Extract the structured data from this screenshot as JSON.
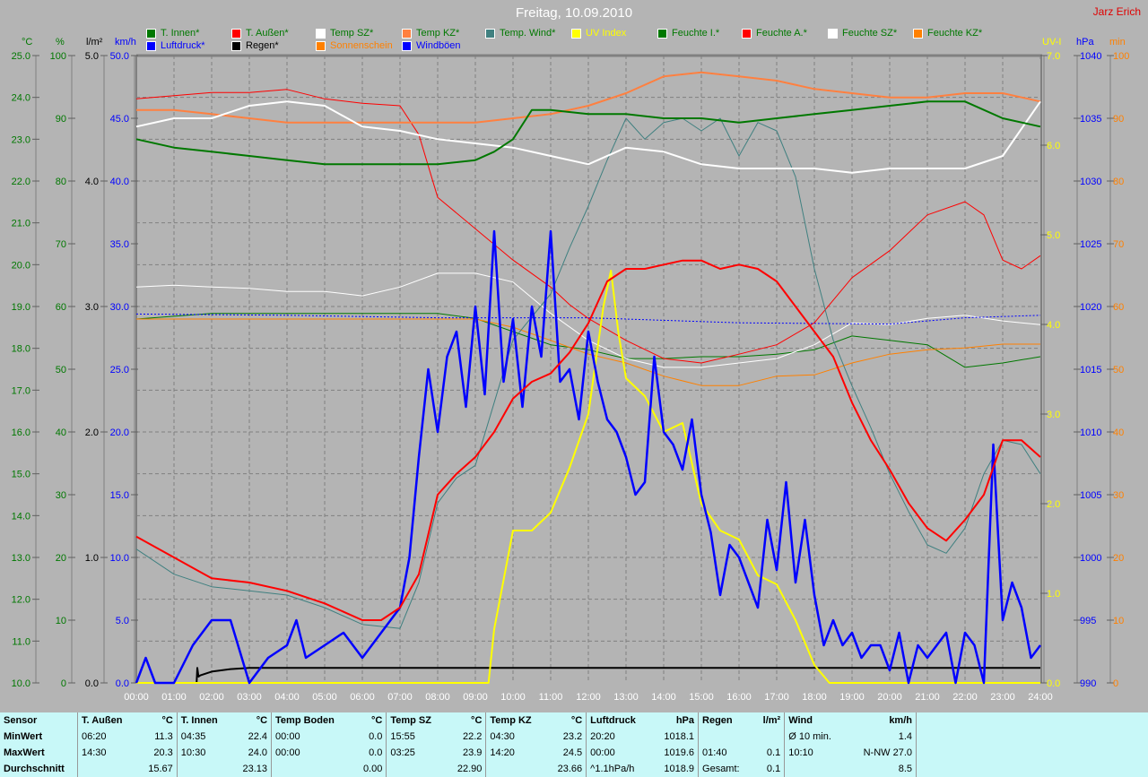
{
  "title": "Freitag, 10.09.2010",
  "author": "Jarz Erich",
  "legend": [
    {
      "label": "T. Innen*",
      "color": "#007800",
      "text": "#007800"
    },
    {
      "label": "Luftdruck*",
      "color": "#0000ff",
      "text": "#0000ff"
    },
    {
      "label": "T. Außen*",
      "color": "#ff0000",
      "text": "#007800"
    },
    {
      "label": "Regen*",
      "color": "#000000",
      "text": "#000000"
    },
    {
      "label": "Temp SZ*",
      "color": "#ffffff",
      "text": "#007800"
    },
    {
      "label": "Sonnenschein",
      "color": "#ff8000",
      "text": "#ff8000"
    },
    {
      "label": "Temp KZ*",
      "color": "#ff8040",
      "text": "#007800"
    },
    {
      "label": "Windböen",
      "color": "#0000ff",
      "text": "#0000ff"
    },
    {
      "label": "Temp. Wind*",
      "color": "#408080",
      "text": "#007800"
    },
    {
      "label": "UV Index",
      "color": "#ffff00",
      "text": "#ffff00"
    },
    {
      "label": "Feuchte I.*",
      "color": "#007800",
      "text": "#007800"
    },
    {
      "label": "Feuchte A.*",
      "color": "#ff0000",
      "text": "#007800"
    },
    {
      "label": "Feuchte SZ*",
      "color": "#ffffff",
      "text": "#007800"
    },
    {
      "label": "Feuchte KZ*",
      "color": "#ff8000",
      "text": "#007800"
    }
  ],
  "chart_data": {
    "type": "line",
    "title": "Freitag, 10.09.2010",
    "x_ticks": [
      "00:00",
      "01:00",
      "02:00",
      "03:00",
      "04:00",
      "05:00",
      "06:00",
      "07:00",
      "08:00",
      "09:00",
      "10:00",
      "11:00",
      "12:00",
      "13:00",
      "14:00",
      "15:00",
      "16:00",
      "17:00",
      "18:00",
      "19:00",
      "20:00",
      "21:00",
      "22:00",
      "23:00",
      "24:00"
    ],
    "xlim": [
      0,
      24
    ],
    "grid": true,
    "axes": [
      {
        "id": "c",
        "unit": "°C",
        "min": 10,
        "max": 25,
        "step": 1,
        "decimals": 1,
        "color": "#007800",
        "side": "left"
      },
      {
        "id": "pct",
        "unit": "%",
        "min": 0,
        "max": 100,
        "step": 10,
        "decimals": 0,
        "color": "#007800",
        "side": "left"
      },
      {
        "id": "rain",
        "unit": "l/m²",
        "min": 0,
        "max": 5,
        "step": 1,
        "decimals": 1,
        "color": "#000000",
        "side": "left"
      },
      {
        "id": "kmh",
        "unit": "km/h",
        "min": 0,
        "max": 50,
        "step": 5,
        "decimals": 1,
        "color": "#0000ff",
        "side": "left"
      },
      {
        "id": "uv",
        "unit": "UV-I",
        "min": 0,
        "max": 7,
        "step": 1,
        "decimals": 1,
        "color": "#ffff00",
        "side": "right"
      },
      {
        "id": "hpa",
        "unit": "hPa",
        "min": 990,
        "max": 1040,
        "step": 5,
        "decimals": 0,
        "color": "#0000ff",
        "side": "right"
      },
      {
        "id": "min",
        "unit": "min",
        "min": 0,
        "max": 100,
        "step": 10,
        "decimals": 0,
        "color": "#ff8000",
        "side": "right"
      }
    ],
    "series": [
      {
        "name": "Feuchte I.*",
        "axis": "pct",
        "color": "#007800",
        "width": 1,
        "x": [
          0,
          2,
          8,
          9,
          10,
          11,
          12,
          13,
          14,
          15,
          16,
          17,
          18,
          19,
          20,
          21,
          22,
          23,
          24
        ],
        "y": [
          58,
          58.9,
          58.9,
          58.1,
          56,
          53.9,
          53.1,
          51.7,
          51.7,
          52,
          52,
          52.4,
          53.1,
          55.3,
          54.6,
          53.9,
          50.3,
          51,
          52
        ]
      },
      {
        "name": "Feuchte A.*",
        "axis": "pct",
        "color": "#ff0000",
        "width": 1,
        "x": [
          0,
          2,
          3,
          4,
          5,
          6,
          7,
          7.5,
          8,
          9,
          10,
          11,
          11.5,
          12,
          13,
          14,
          15,
          16,
          17,
          18,
          19,
          20,
          21,
          22,
          22.5,
          23,
          23.5,
          24
        ],
        "y": [
          93.1,
          94.1,
          94.1,
          94.6,
          93.1,
          92.4,
          92,
          87.4,
          77.4,
          72.4,
          67.4,
          63.1,
          60.3,
          58.1,
          54.6,
          51.7,
          51,
          52.4,
          53.9,
          57.4,
          64.6,
          68.9,
          74.6,
          76.7,
          74.6,
          67.4,
          66,
          68.1
        ]
      },
      {
        "name": "Feuchte SZ*",
        "axis": "pct",
        "color": "#ffffff",
        "width": 1,
        "x": [
          0,
          1,
          2,
          3,
          4,
          5,
          6,
          7,
          8,
          9,
          10,
          11,
          12,
          13,
          14,
          15,
          16,
          17,
          18,
          19,
          20,
          21,
          22,
          23,
          24
        ],
        "y": [
          63.1,
          63.4,
          63.1,
          62.9,
          62.4,
          62.4,
          61.7,
          63.1,
          65.3,
          65.3,
          63.9,
          58.9,
          54.6,
          51.7,
          50.3,
          50.3,
          51,
          51.7,
          53.9,
          57.4,
          57.1,
          58.1,
          58.6,
          57.7,
          57.1
        ]
      },
      {
        "name": "Feuchte KZ*",
        "axis": "pct",
        "color": "#ff8000",
        "width": 1,
        "x": [
          0,
          6,
          8,
          9,
          10,
          11,
          12,
          13,
          14,
          15,
          16,
          17,
          18,
          19,
          20,
          21,
          22,
          23,
          24
        ],
        "y": [
          58,
          58,
          58,
          58,
          56.7,
          54.6,
          52.4,
          51,
          48.9,
          47.4,
          47.4,
          48.9,
          49.1,
          51,
          52.4,
          53.1,
          53.4,
          54,
          54
        ]
      },
      {
        "name": "Temp. Wind*",
        "axis": "c",
        "color": "#408080",
        "width": 1,
        "x": [
          0,
          1,
          2,
          3,
          4,
          5,
          6,
          7,
          7.5,
          8,
          8.5,
          9,
          9.5,
          10,
          11,
          11.5,
          12,
          12.5,
          13,
          13.5,
          14,
          14.5,
          15,
          15.5,
          16,
          16.5,
          17,
          17.5,
          18,
          18.5,
          19,
          19.5,
          20,
          20.5,
          21,
          21.5,
          22,
          22.5,
          23,
          23.5,
          24
        ],
        "y": [
          13.2,
          12.6,
          12.3,
          12.2,
          12.1,
          11.8,
          11.4,
          11.3,
          12.4,
          14.3,
          14.9,
          15.2,
          16.7,
          18.2,
          19.3,
          20.4,
          21.4,
          22.5,
          23.5,
          23.0,
          23.4,
          23.5,
          23.2,
          23.5,
          22.6,
          23.4,
          23.2,
          22.1,
          19.9,
          18.2,
          17.1,
          16.1,
          15.0,
          14.1,
          13.3,
          13.1,
          13.7,
          15.0,
          15.8,
          15.7,
          15.0
        ]
      },
      {
        "name": "Regen*",
        "axis": "rain",
        "color": "#000000",
        "width": 2,
        "x": [
          0,
          1.6,
          1.62,
          1.65,
          1.7,
          2,
          2.5,
          3,
          24
        ],
        "y": [
          0,
          0,
          0.12,
          0.05,
          0.06,
          0.09,
          0.11,
          0.12,
          0.12
        ]
      },
      {
        "name": "UV Index",
        "axis": "uv",
        "color": "#ffff00",
        "width": 2,
        "x": [
          0,
          9.35,
          9.5,
          10,
          10.5,
          11,
          11.5,
          12,
          12.4,
          12.6,
          12.8,
          13,
          13.5,
          14,
          14.5,
          15,
          15.5,
          16,
          16.5,
          17,
          17.5,
          18,
          18.4,
          24
        ],
        "y": [
          0,
          0,
          0.6,
          1.7,
          1.7,
          1.9,
          2.4,
          3.0,
          4.2,
          4.6,
          3.9,
          3.4,
          3.2,
          2.8,
          2.9,
          2.0,
          1.7,
          1.6,
          1.2,
          1.1,
          0.7,
          0.2,
          0,
          0
        ]
      },
      {
        "name": "Luftdruck*",
        "axis": "hpa",
        "color": "#0000ff",
        "width": 1,
        "dash": "2,2",
        "x": [
          0,
          4,
          8,
          12,
          16,
          20,
          22,
          24
        ],
        "y": [
          1019.4,
          1019.3,
          1019.1,
          1019.1,
          1018.7,
          1018.6,
          1019.1,
          1019.3
        ]
      },
      {
        "name": "Windböen",
        "axis": "kmh",
        "color": "#0000ff",
        "width": 2.5,
        "x": [
          0,
          0.25,
          0.5,
          1,
          1.5,
          2,
          2.5,
          3,
          3.5,
          4,
          4.25,
          4.5,
          5,
          5.5,
          6,
          6.5,
          7,
          7.25,
          7.5,
          7.75,
          8,
          8.25,
          8.5,
          8.75,
          9,
          9.25,
          9.5,
          9.75,
          10,
          10.25,
          10.5,
          10.75,
          11,
          11.25,
          11.5,
          11.75,
          12,
          12.25,
          12.5,
          12.75,
          13,
          13.25,
          13.5,
          13.75,
          14,
          14.25,
          14.5,
          14.75,
          15,
          15.25,
          15.5,
          15.75,
          16,
          16.25,
          16.5,
          16.75,
          17,
          17.25,
          17.5,
          17.75,
          18,
          18.25,
          18.5,
          18.75,
          19,
          19.25,
          19.5,
          19.75,
          20,
          20.25,
          20.5,
          20.75,
          21,
          21.25,
          21.5,
          21.75,
          22,
          22.25,
          22.5,
          22.75,
          23,
          23.25,
          23.5,
          23.75,
          24
        ],
        "y": [
          0,
          2,
          0,
          0,
          3,
          5,
          5,
          0,
          2,
          3,
          5,
          2,
          3,
          4,
          2,
          4,
          6,
          10,
          18,
          25,
          20,
          26,
          28,
          22,
          30,
          23,
          36,
          24,
          29,
          22,
          30,
          26,
          36,
          24,
          25,
          21,
          28,
          24,
          21,
          20,
          18,
          15,
          16,
          26,
          20,
          19,
          17,
          21,
          15,
          12,
          7,
          11,
          10,
          8,
          6,
          13,
          9,
          16,
          8,
          13,
          7,
          3,
          5,
          3,
          4,
          2,
          3,
          3,
          1,
          4,
          0,
          3,
          2,
          3,
          4,
          0,
          4,
          3,
          0,
          19,
          5,
          8,
          6,
          2,
          3
        ]
      },
      {
        "name": "Temp KZ*",
        "axis": "c",
        "color": "#ff8040",
        "width": 2,
        "x": [
          0,
          1,
          2,
          3,
          4,
          5,
          6,
          7,
          8,
          9,
          10,
          11,
          12,
          13,
          14,
          15,
          16,
          17,
          18,
          19,
          20,
          21,
          22,
          23,
          24
        ],
        "y": [
          23.7,
          23.7,
          23.6,
          23.5,
          23.4,
          23.4,
          23.4,
          23.4,
          23.4,
          23.4,
          23.5,
          23.6,
          23.8,
          24.1,
          24.5,
          24.6,
          24.5,
          24.4,
          24.2,
          24.1,
          24.0,
          24.0,
          24.1,
          24.1,
          23.9
        ]
      },
      {
        "name": "Temp SZ*",
        "axis": "c",
        "color": "#ffffff",
        "width": 2,
        "x": [
          0,
          1,
          2,
          3,
          4,
          5,
          6,
          7,
          8,
          9,
          10,
          11,
          12,
          13,
          14,
          15,
          16,
          17,
          18,
          19,
          20,
          21,
          22,
          23,
          24
        ],
        "y": [
          23.3,
          23.5,
          23.5,
          23.8,
          23.9,
          23.8,
          23.3,
          23.2,
          23.0,
          22.9,
          22.8,
          22.6,
          22.4,
          22.8,
          22.7,
          22.4,
          22.3,
          22.3,
          22.3,
          22.2,
          22.3,
          22.3,
          22.3,
          22.6,
          23.9
        ]
      },
      {
        "name": "T. Innen*",
        "axis": "c",
        "color": "#007800",
        "width": 2,
        "x": [
          0,
          1,
          2,
          3,
          4,
          5,
          6,
          7,
          8,
          9,
          9.5,
          10,
          10.5,
          11,
          12,
          13,
          14,
          15,
          16,
          17,
          18,
          19,
          20,
          21,
          22,
          23,
          24
        ],
        "y": [
          23.0,
          22.8,
          22.7,
          22.6,
          22.5,
          22.4,
          22.4,
          22.4,
          22.4,
          22.5,
          22.7,
          23.0,
          23.7,
          23.7,
          23.6,
          23.6,
          23.5,
          23.5,
          23.4,
          23.5,
          23.6,
          23.7,
          23.8,
          23.9,
          23.9,
          23.5,
          23.3
        ]
      },
      {
        "name": "T. Außen*",
        "axis": "c",
        "color": "#ff0000",
        "width": 2,
        "x": [
          0,
          1,
          2,
          3,
          4,
          5,
          6,
          6.5,
          7,
          7.5,
          8,
          8.5,
          9,
          9.5,
          10,
          10.5,
          11,
          11.5,
          12,
          12.5,
          13,
          13.5,
          14,
          14.5,
          15,
          15.5,
          16,
          16.5,
          17,
          17.5,
          18,
          18.5,
          19,
          19.5,
          20,
          20.5,
          21,
          21.5,
          22,
          22.5,
          23,
          23.5,
          24
        ],
        "y": [
          13.5,
          13.0,
          12.5,
          12.4,
          12.2,
          11.9,
          11.5,
          11.5,
          11.8,
          12.6,
          14.5,
          15.0,
          15.4,
          16.0,
          16.8,
          17.2,
          17.4,
          17.9,
          18.6,
          19.6,
          19.9,
          19.9,
          20.0,
          20.1,
          20.1,
          19.9,
          20.0,
          19.9,
          19.6,
          19.0,
          18.4,
          17.8,
          16.7,
          15.8,
          15.1,
          14.3,
          13.7,
          13.4,
          13.9,
          14.5,
          15.8,
          15.8,
          15.4
        ]
      }
    ]
  },
  "stats": {
    "headers": [
      "Sensor",
      "T. Außen",
      "°C",
      "T. Innen",
      "°C",
      "Temp Boden",
      "°C",
      "Temp SZ",
      "°C",
      "Temp KZ",
      "°C",
      "Luftdruck",
      "hPa",
      "Regen",
      "l/m²",
      "Wind",
      "km/h"
    ],
    "rows": [
      [
        "MinWert",
        "06:20",
        "11.3",
        "04:35",
        "22.4",
        "00:00",
        "0.0",
        "15:55",
        "22.2",
        "04:30",
        "23.2",
        "20:20",
        "1018.1",
        "",
        "",
        "Ø 10 min.",
        "1.4"
      ],
      [
        "MaxWert",
        "14:30",
        "20.3",
        "10:30",
        "24.0",
        "00:00",
        "0.0",
        "03:25",
        "23.9",
        "14:20",
        "24.5",
        "00:00",
        "1019.6",
        "01:40",
        "0.1",
        "10:10",
        "N-NW 27.0"
      ],
      [
        "Durchschnitt",
        "",
        "15.67",
        "",
        "23.13",
        "",
        "0.00",
        "",
        "22.90",
        "",
        "23.66",
        "^1.1hPa/h",
        "1018.9",
        "Gesamt:",
        "0.1",
        "",
        "8.5"
      ]
    ]
  }
}
